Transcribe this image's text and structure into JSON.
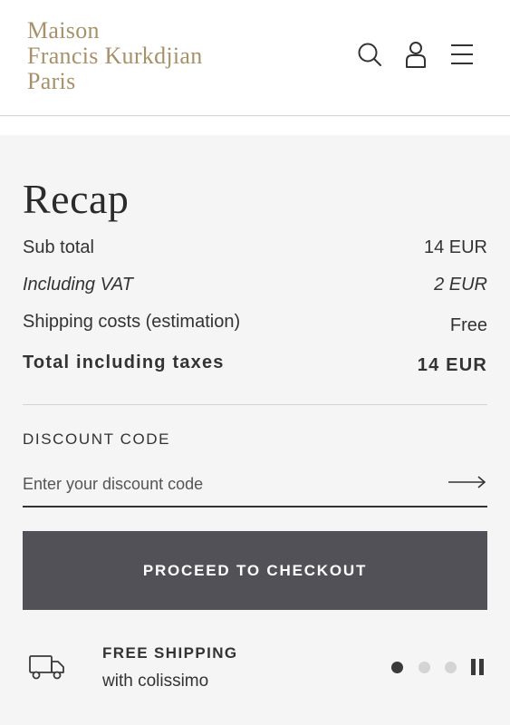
{
  "header": {
    "logo_lines": [
      "Maison",
      "Francis Kurkdjian",
      "Paris"
    ],
    "icons": {
      "search": "search-icon",
      "account": "user-icon",
      "menu": "hamburger-menu-icon"
    }
  },
  "recap": {
    "title": "Recap",
    "rows": [
      {
        "label": "Sub total",
        "value": "14 EUR"
      },
      {
        "label": "Including VAT",
        "value": "2 EUR"
      },
      {
        "label": "Shipping costs (estimation)",
        "value": "Free"
      },
      {
        "label": "Total including taxes",
        "value": "14 EUR"
      }
    ]
  },
  "discount": {
    "label": "DISCOUNT CODE",
    "placeholder": "Enter your discount code",
    "value": ""
  },
  "checkout": {
    "label": "PROCEED TO CHECKOUT"
  },
  "shipping_banner": {
    "title": "FREE SHIPPING",
    "subtitle": "with colissimo",
    "slide_count": 3,
    "active_slide": 1
  },
  "colors": {
    "logo_gold": "#a8916a",
    "button_bg": "#515157",
    "panel_bg": "#f5f5f5",
    "dot_active": "#3a3a3a",
    "dot_inactive": "#d4d4d4"
  }
}
